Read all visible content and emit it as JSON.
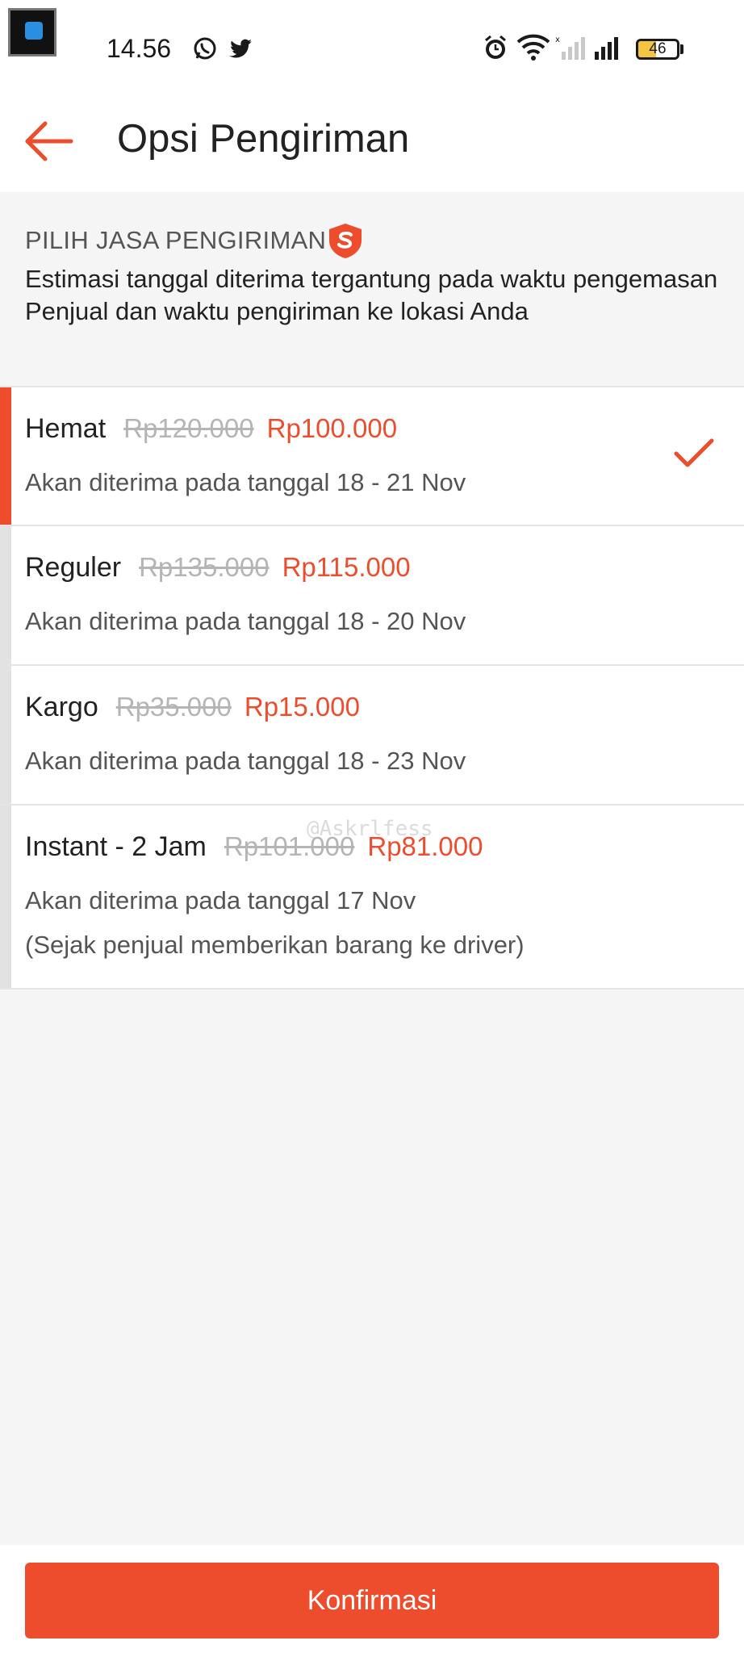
{
  "status_bar": {
    "time": "14.56",
    "battery_level": "46",
    "battery_fraction": 0.46,
    "left_icons": [
      "whatsapp-icon",
      "twitter-icon"
    ],
    "right_icons": [
      "alarm-icon",
      "wifi-icon",
      "signal-sim1-icon",
      "signal-sim2-icon",
      "battery-icon"
    ]
  },
  "header": {
    "title": "Opsi Pengiriman",
    "back_icon": "back-arrow-icon"
  },
  "info": {
    "heading": "PILIH JASA PENGIRIMAN",
    "heading_icon": "shopee-shield-icon",
    "text": "Estimasi tanggal diterima tergantung pada waktu pengemasan Penjual dan waktu pengiriman ke lokasi Anda"
  },
  "options": [
    {
      "name": "Hemat",
      "old_price": "Rp120.000",
      "new_price": "Rp100.000",
      "eta": "Akan diterima pada tanggal 18 - 21 Nov",
      "note": "",
      "selected": true
    },
    {
      "name": "Reguler",
      "old_price": "Rp135.000",
      "new_price": "Rp115.000",
      "eta": "Akan diterima pada tanggal 18 - 20 Nov",
      "note": "",
      "selected": false
    },
    {
      "name": "Kargo",
      "old_price": "Rp35.000",
      "new_price": "Rp15.000",
      "eta": "Akan diterima pada tanggal 18 - 23 Nov",
      "note": "",
      "selected": false
    },
    {
      "name": "Instant - 2 Jam",
      "old_price": "Rp101.000",
      "new_price": "Rp81.000",
      "eta": "Akan diterima pada tanggal 17 Nov",
      "note": "(Sejak penjual memberikan barang ke driver)",
      "selected": false
    }
  ],
  "watermark": "@Askrlfess",
  "confirm_label": "Konfirmasi",
  "colors": {
    "accent": "#ee4d2d",
    "strike_price": "#b5b5b5",
    "selected_check": "#ee4d2d"
  }
}
